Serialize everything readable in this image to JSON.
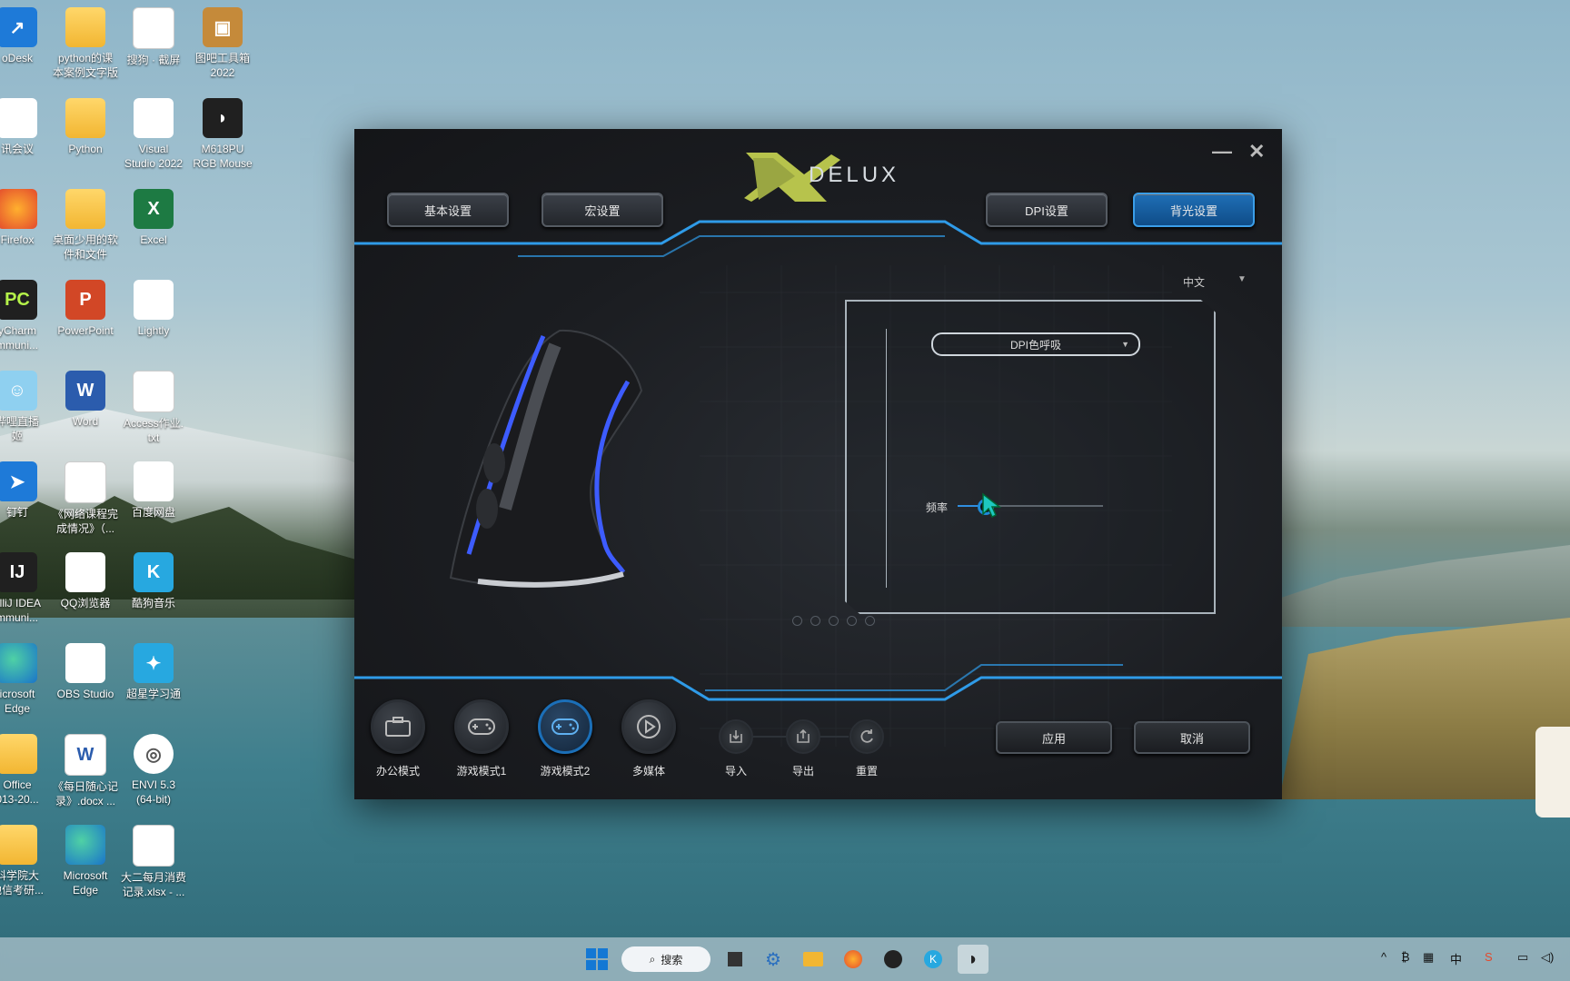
{
  "desktop": {
    "icons": [
      {
        "label": "oDesk"
      },
      {
        "label": "python的课\n本案例文字版"
      },
      {
        "label": "搜狗 · 截屏"
      },
      {
        "label": "图吧工具箱\n2022"
      },
      {
        "label": "讯会议"
      },
      {
        "label": "Python"
      },
      {
        "label": "Visual\nStudio 2022"
      },
      {
        "label": "M618PU\nRGB Mouse"
      },
      {
        "label": "Firefox"
      },
      {
        "label": "桌面少用的软\n件和文件"
      },
      {
        "label": "Excel"
      },
      {
        "label": "yCharm\nmmuni..."
      },
      {
        "label": "PowerPoint"
      },
      {
        "label": "Lightly"
      },
      {
        "label": "哔哩直播\n姬"
      },
      {
        "label": "Word"
      },
      {
        "label": "Access作业.\ntxt"
      },
      {
        "label": "钉钉"
      },
      {
        "label": "《网络课程完\n成情况》（..."
      },
      {
        "label": "百度网盘"
      },
      {
        "label": "elliJ IDEA\nmmuni..."
      },
      {
        "label": "QQ浏览器"
      },
      {
        "label": "酷狗音乐"
      },
      {
        "label": "icrosoft\nEdge"
      },
      {
        "label": "OBS Studio"
      },
      {
        "label": "超星学习通"
      },
      {
        "label": "Office\n013-20..."
      },
      {
        "label": "《每日随心记\n录》.docx ..."
      },
      {
        "label": "ENVI 5.3\n(64-bit)"
      },
      {
        "label": "科学院大\n他信考研..."
      },
      {
        "label": "Microsoft\nEdge"
      },
      {
        "label": "大二每月消费\n记录.xlsx - ..."
      }
    ]
  },
  "app": {
    "brand": "DELUX",
    "minimize": "—",
    "close": "✕",
    "top_tabs": {
      "basic": "基本设置",
      "macro": "宏设置",
      "dpi": "DPI设置",
      "backlight": "背光设置"
    },
    "language": "中文",
    "light_mode": "DPI色呼吸",
    "frequency_label": "频率",
    "frequency_value": 0.18,
    "modes": [
      {
        "label": "办公模式"
      },
      {
        "label": "游戏模式1"
      },
      {
        "label": "游戏模式2"
      },
      {
        "label": "多媒体"
      }
    ],
    "file_actions": {
      "import": "导入",
      "export": "导出",
      "reset": "重置"
    },
    "apply": "应用",
    "cancel": "取消"
  },
  "taskbar": {
    "search": "搜索",
    "ime": "中"
  },
  "colors": {
    "accent": "#1e8ad8",
    "neon": "#2f9be8"
  }
}
